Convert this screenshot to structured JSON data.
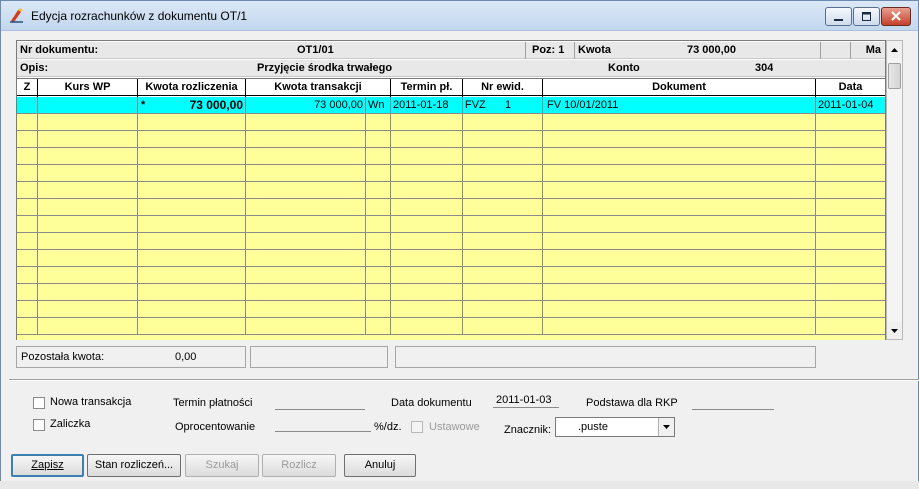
{
  "window": {
    "title": "Edycja rozrachunków z dokumentu OT/1"
  },
  "doc_header": {
    "nr_label": "Nr dokumentu:",
    "nr_value": "OT1/01",
    "poz_label": "Poz: 1",
    "kwota_label": "Kwota",
    "kwota_value": "73 000,00",
    "side": "Ma",
    "opis_label": "Opis:",
    "opis_value": "Przyjęcie środka trwałego",
    "konto_label": "Konto",
    "konto_value": "304"
  },
  "columns": [
    "Z",
    "Kurs WP",
    "Kwota rozliczenia",
    "Kwota transakcji",
    "",
    "Termin pł.",
    "Nr ewid.",
    "Dokument",
    "Data"
  ],
  "rows": [
    {
      "z": "",
      "kurs_wp": "",
      "marker": "*",
      "kwota_rozliczenia": "73 000,00",
      "kwota_transakcji": "73 000,00",
      "strona": "Wn",
      "termin": "2011-01-18",
      "nr_ewid_type": "FVZ",
      "nr_ewid_num": "1",
      "dokument": "FV 10/01/2011",
      "data": "2011-01-04"
    }
  ],
  "status": {
    "pozostala_label": "Pozostała kwota:",
    "pozostala_value": "0,00"
  },
  "form": {
    "nowa_transakcja": "Nowa transakcja",
    "zaliczka": "Zaliczka",
    "termin_platnosci": "Termin płatności",
    "oprocentowanie": "Oprocentowanie",
    "proc_unit": "%/dz.",
    "ustawowe": "Ustawowe",
    "data_dokumentu_label": "Data dokumentu",
    "data_dokumentu_value": "2011-01-03",
    "podstawa_rkp": "Podstawa dla RKP",
    "znacznik_label": "Znacznik:",
    "znacznik_value": ".puste"
  },
  "buttons": {
    "zapisz": "Zapisz",
    "stan": "Stan rozliczeń...",
    "szukaj": "Szukaj",
    "rozlicz": "Rozlicz",
    "anuluj": "Anuluj"
  }
}
